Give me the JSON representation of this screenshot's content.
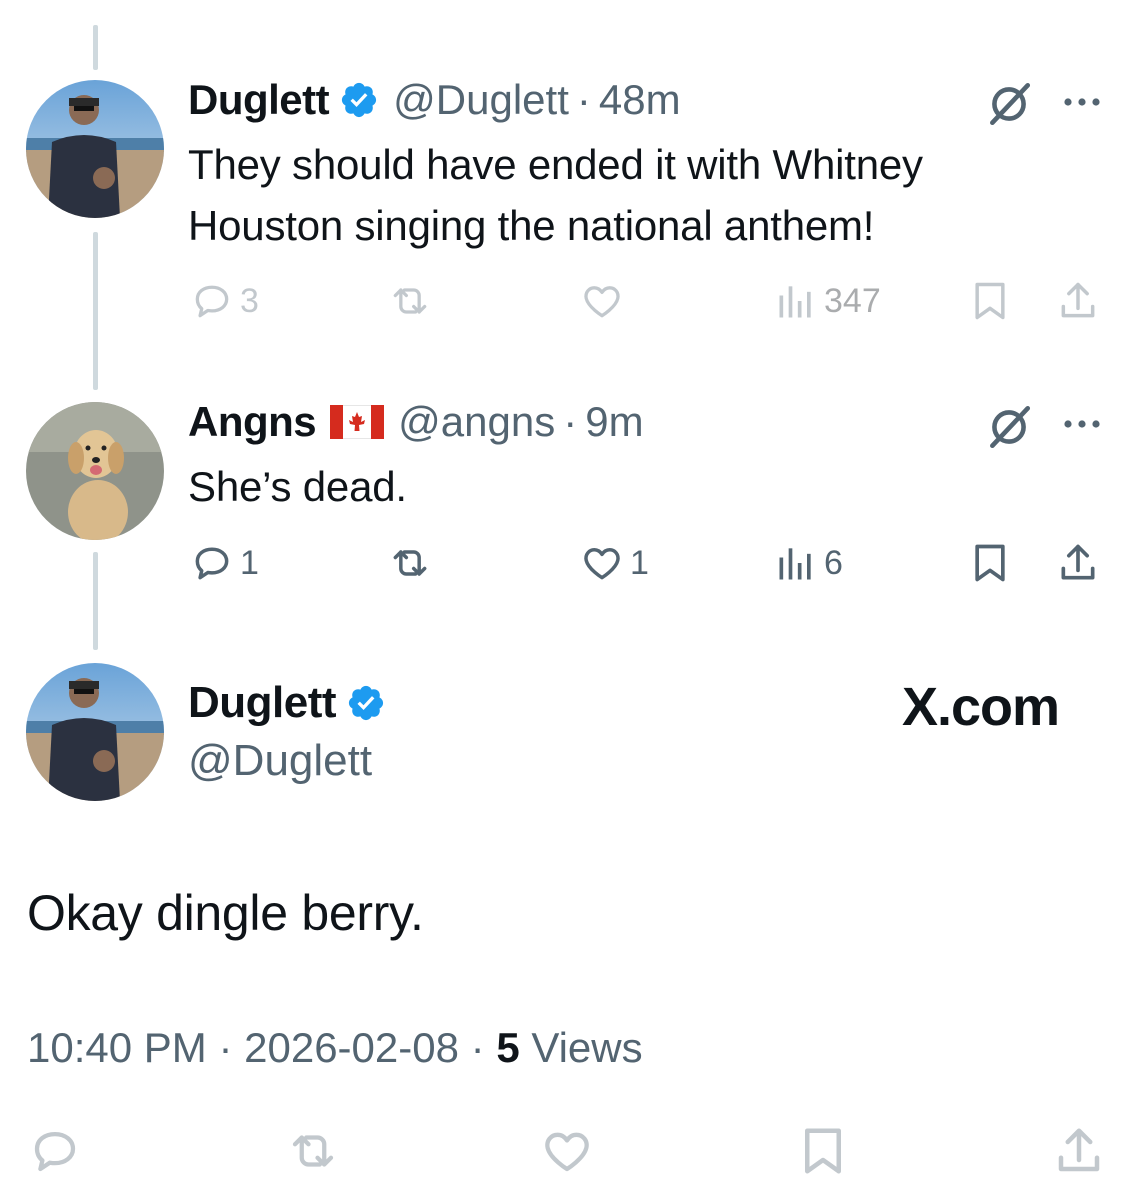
{
  "tweets": [
    {
      "name": "Duglett",
      "handle": "@Duglett",
      "time": "48m",
      "text_lines": [
        "They should have ended it with Whitney",
        "Houston singing the national anthem!"
      ],
      "replies": "3",
      "views": "347"
    },
    {
      "name": "Angns",
      "flag": "canada-flag-icon",
      "handle": "@angns",
      "time": "9m",
      "text": "She’s dead.",
      "replies": "1",
      "likes": "1",
      "views": "6"
    }
  ],
  "main": {
    "name": "Duglett",
    "handle": "@Duglett",
    "watermark": "X.com",
    "text": "Okay dingle berry.",
    "time": "10:40 PM",
    "date": "2026-02-08",
    "views_count": "5",
    "views_label": "Views"
  },
  "separator": "·",
  "colors": {
    "verified_blue": "#1d9bf0",
    "secondary_text": "#536471",
    "thread_line": "#cfd9de",
    "icon_gray": "#536471"
  }
}
